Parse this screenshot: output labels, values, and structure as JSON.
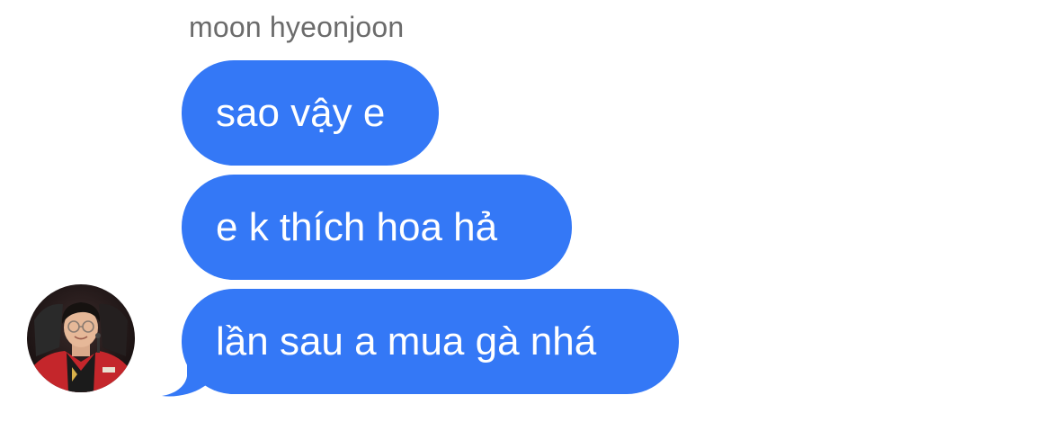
{
  "thread": {
    "sender_name": "moon hyeonjoon",
    "messages": [
      {
        "text": "sao vậy e"
      },
      {
        "text": "e k thích hoa hả"
      },
      {
        "text": "lần sau a mua gà nhá"
      }
    ]
  },
  "colors": {
    "incoming_bubble": "#3478f6",
    "bubble_text": "#ffffff",
    "sender_name": "#6b6b6b",
    "background": "#ffffff"
  },
  "avatar": {
    "icon": "user-photo-avatar"
  }
}
